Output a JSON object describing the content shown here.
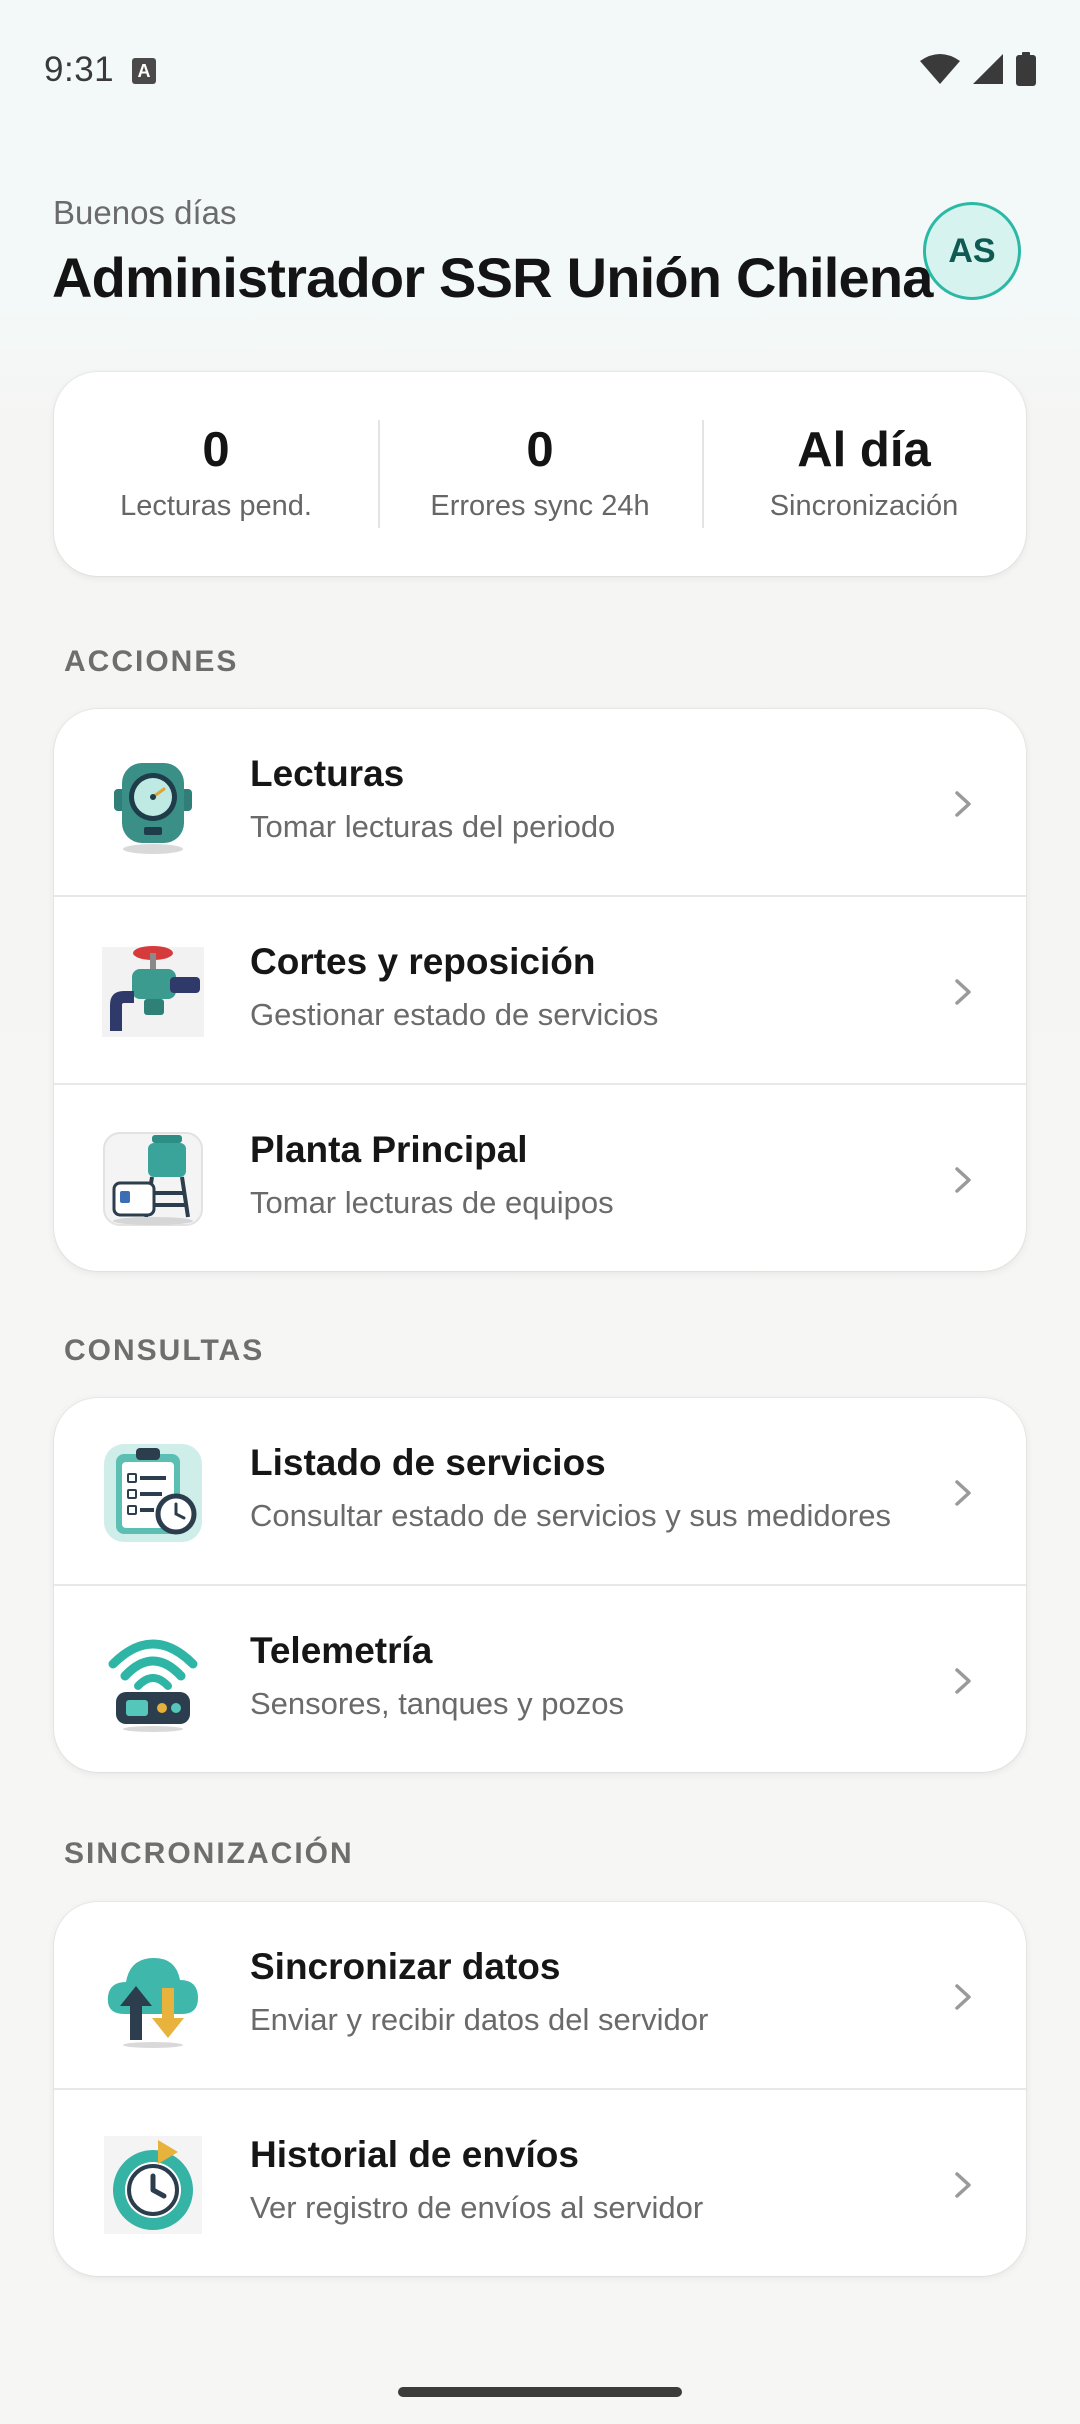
{
  "status_bar": {
    "time": "9:31",
    "notification_icon": "a-text-icon",
    "icons": [
      "wifi-icon",
      "signal-icon",
      "battery-icon"
    ]
  },
  "header": {
    "greeting": "Buenos días",
    "user_name": "Administrador SSR Unión Chilena",
    "avatar_initials": "AS"
  },
  "stats": [
    {
      "value": "0",
      "label": "Lecturas pend."
    },
    {
      "value": "0",
      "label": "Errores sync 24h"
    },
    {
      "value": "Al día",
      "label": "Sincronización"
    }
  ],
  "sections": {
    "acciones": {
      "title": "ACCIONES",
      "items": [
        {
          "title": "Lecturas",
          "subtitle": "Tomar lecturas del periodo",
          "icon": "water-meter-icon"
        },
        {
          "title": "Cortes y reposición",
          "subtitle": "Gestionar estado de servicios",
          "icon": "valve-icon"
        },
        {
          "title": "Planta Principal",
          "subtitle": "Tomar lecturas de equipos",
          "icon": "water-plant-icon"
        }
      ]
    },
    "consultas": {
      "title": "CONSULTAS",
      "items": [
        {
          "title": "Listado de servicios",
          "subtitle": "Consultar estado de servicios y sus medidores",
          "icon": "clipboard-list-icon"
        },
        {
          "title": "Telemetría",
          "subtitle": "Sensores, tanques y pozos",
          "icon": "telemetry-icon"
        }
      ]
    },
    "sincronizacion": {
      "title": "SINCRONIZACIÓN",
      "items": [
        {
          "title": "Sincronizar datos",
          "subtitle": "Enviar y recibir datos del servidor",
          "icon": "cloud-sync-icon"
        },
        {
          "title": "Historial de envíos",
          "subtitle": "Ver registro de envíos al servidor",
          "icon": "history-clock-icon"
        }
      ]
    }
  },
  "colors": {
    "accent": "#2bb9a5",
    "accent_dark": "#0f5a52",
    "background_top": "#f3f9f8",
    "background": "#f6f6f5",
    "card": "#ffffff"
  }
}
